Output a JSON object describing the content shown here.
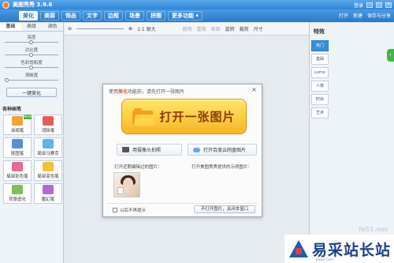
{
  "titlebar": {
    "app_name": "美图秀秀 3.9.6",
    "login": "登录",
    "min": "–",
    "max": "□",
    "close": "×"
  },
  "menubar": {
    "tabs": [
      "美化",
      "美容",
      "饰品",
      "文字",
      "边框",
      "场景",
      "拼图",
      "更多功能 ▾"
    ],
    "active_index": 0,
    "right": {
      "open": "打开",
      "new": "新建",
      "save_share": "保存与分享"
    }
  },
  "left_panel": {
    "tabs": [
      "基础",
      "高级",
      "调色"
    ],
    "sliders": [
      {
        "label": "亮度",
        "level": 0.5
      },
      {
        "label": "对比度",
        "level": 0.5
      },
      {
        "label": "色彩饱和度",
        "level": 0.5
      },
      {
        "label": "清晰度",
        "level": 0.0
      }
    ],
    "one_key_label": "一键美化",
    "brushes_title": "各种画笔",
    "brushes": [
      {
        "label": "涂鸦笔",
        "icon": "doodle-pen-icon",
        "color": "#f2a13a",
        "new": true
      },
      {
        "label": "消除笔",
        "icon": "eraser-pen-icon",
        "color": "#e85b5b",
        "new": false
      },
      {
        "label": "抠图笔",
        "icon": "cutout-pen-icon",
        "color": "#5a8fd6",
        "new": false
      },
      {
        "label": "局部马赛克",
        "icon": "mosaic-icon",
        "color": "#5bb3e8",
        "new": false
      },
      {
        "label": "局部彩色笔",
        "icon": "color-pen-icon",
        "color": "#e86a9a",
        "new": false
      },
      {
        "label": "局部变色笔",
        "icon": "recolor-pen-icon",
        "color": "#f0c23a",
        "new": false
      },
      {
        "label": "背景虚化",
        "icon": "blur-bg-icon",
        "color": "#7fbf5a",
        "new": false
      },
      {
        "label": "魔幻笔",
        "icon": "magic-pen-icon",
        "color": "#b46ad6",
        "new": false
      }
    ],
    "new_tag": "NEW"
  },
  "toolbar": {
    "zoom_label": "1:1 原大",
    "rotate": "旋转",
    "crop": "裁剪",
    "size": "尺寸",
    "disabled_items": [
      "撤销",
      "重做",
      "原图"
    ]
  },
  "right_panel": {
    "title": "特效",
    "tabs": [
      "热门",
      "基础",
      "Lomo",
      "人像",
      "时尚",
      "艺术"
    ],
    "active_index": 0
  },
  "dialog": {
    "head_prefix": "使用",
    "head_highlight": "美化",
    "head_suffix": "功能前，请先打开一张图片",
    "open_label": "打开一张图片",
    "camera_label": "用摄像头拍照",
    "cloud_label": "打开百度云网盘图片",
    "recent_label": "打开近期编辑过的图片：",
    "sample_label": "打开美图秀秀提供的示例图片：",
    "checkbox_label": "以后不再提示",
    "no_open_label": "不打开图片，关闭本窗口"
  },
  "watermark": {
    "url": "ib51.net",
    "site": "易采站长站",
    "small": "Easck.Com"
  }
}
